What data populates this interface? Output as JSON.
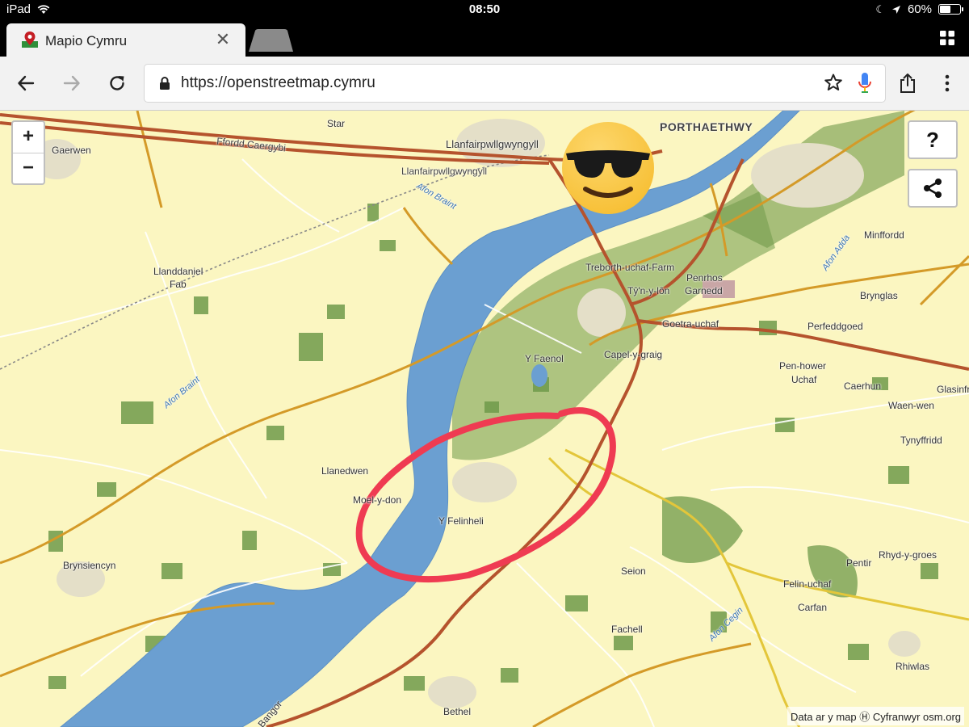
{
  "status_bar": {
    "device": "iPad",
    "time": "08:50",
    "battery": "60%",
    "battery_level": 0.6
  },
  "tab": {
    "title": "Mapio Cymru"
  },
  "toolbar": {
    "url": "https://openstreetmap.cymru"
  },
  "map": {
    "zoom_in": "+",
    "zoom_out": "−",
    "help": "?",
    "attribution_prefix": "Data ar y map",
    "attribution_suffix": "Cyfranwyr osm.org",
    "labels": {
      "porthaethwy": "PORTHAETHWY",
      "star": "Star",
      "gaerwen": "Gaerwen",
      "ffordd": "Ffordd Caergybi",
      "llanfair1": "Llanfairpwllgwyngyll",
      "llanfair2": "Llanfairpwllgwyngyll",
      "afon_braint_n": "Afon Braint",
      "llanddaniel": "Llanddaniel",
      "fab": "Fab",
      "treborth": "Treborth-uchaf-Farm",
      "tynylon": "Tŷ'n-y-lôn",
      "penrhos": "Penrhos",
      "garnedd": "Garnedd",
      "goetra": "Goetra-uchaf",
      "minffordd": "Minffordd",
      "afon_adda": "Afon Adda",
      "brynglas": "Brynglas",
      "perfeddgoed": "Perfeddgoed",
      "yfaenol": "Y Faenol",
      "capel": "Capel-y-graig",
      "penhower": "Pen-hower",
      "uchaf": "Uchaf",
      "caerhun": "Caerhun",
      "glasinfryn": "Glasinfr",
      "waenwen": "Waen-wen",
      "tynyffridd": "Tynyffridd",
      "afon_braint_s": "Afon Braint",
      "llanedwen": "Llanedwen",
      "moelydon": "Moel-y-don",
      "yfelinheli": "Y Felinheli",
      "brynsiencyn": "Brynsiencyn",
      "seion": "Seion",
      "pentir": "Pentir",
      "rhydygroes": "Rhyd-y-groes",
      "felinuchaf": "Felin-uchaf",
      "carfan": "Carfan",
      "fachell": "Fachell",
      "afon_cegin": "Afon Cegin",
      "rhiwlas": "Rhiwlas",
      "bethel": "Bethel",
      "bangor": "Bangor"
    }
  },
  "colors": {
    "land": "#fbf6c1",
    "water": "#6b9fd1",
    "forest": "#6f9a4a",
    "trunk": "#b5532d",
    "primary": "#d49a28",
    "annotation": "#ef3b52"
  },
  "overlay": {
    "emoji": "smiling-face-with-sunglasses"
  }
}
